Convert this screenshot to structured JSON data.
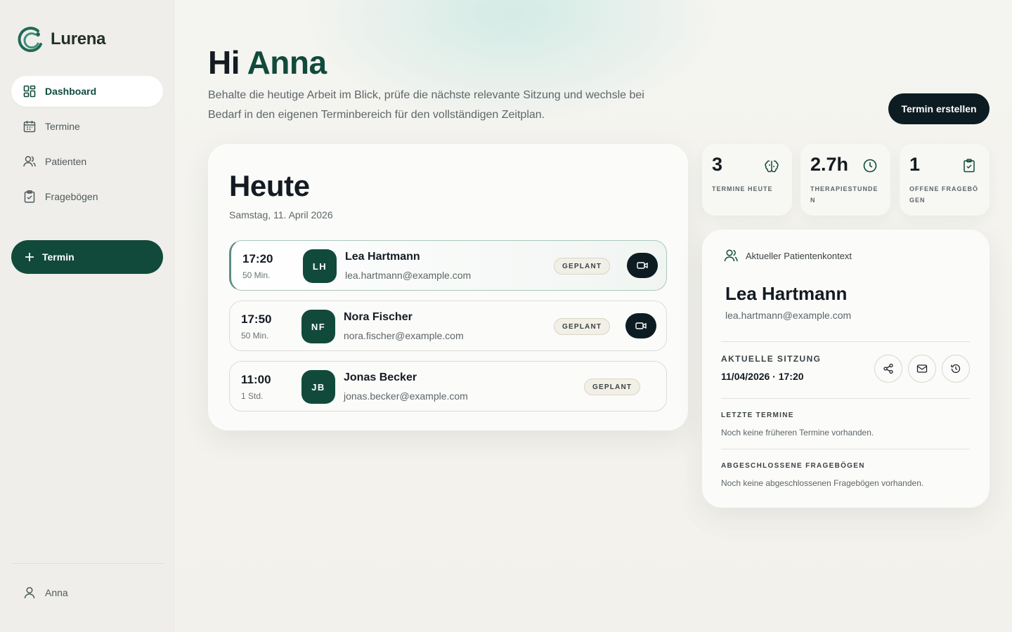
{
  "app": {
    "name": "Lurena"
  },
  "sidebar": {
    "items": [
      {
        "label": "Dashboard",
        "icon": "dashboard-icon",
        "active": true
      },
      {
        "label": "Termine",
        "icon": "calendar-icon"
      },
      {
        "label": "Patienten",
        "icon": "users-icon"
      },
      {
        "label": "Fragebögen",
        "icon": "clipboard-icon"
      }
    ],
    "new_button": "Termin",
    "user": "Anna"
  },
  "header": {
    "greeting": "Hi",
    "name": "Anna",
    "subtitle": "Behalte die heutige Arbeit im Blick, prüfe die nächste relevante Sitzung und wechsle bei Bedarf in den eigenen Terminbereich für den vollständigen Zeitplan.",
    "create_button": "Termin erstellen"
  },
  "today": {
    "title": "Heute",
    "date": "Samstag, 11. April 2026",
    "appointments": [
      {
        "time": "17:20",
        "duration": "50 Min.",
        "initials": "LH",
        "name": "Lea Hartmann",
        "email": "lea.hartmann@example.com",
        "status": "GEPLANT",
        "video": true
      },
      {
        "time": "17:50",
        "duration": "50 Min.",
        "initials": "NF",
        "name": "Nora Fischer",
        "email": "nora.fischer@example.com",
        "status": "GEPLANT",
        "video": true
      },
      {
        "time": "11:00",
        "duration": "1 Std.",
        "initials": "JB",
        "name": "Jonas Becker",
        "email": "jonas.becker@example.com",
        "status": "GEPLANT",
        "video": false
      }
    ]
  },
  "stats": [
    {
      "value": "3",
      "label": "TERMINE HEUTE",
      "icon": "brain-icon"
    },
    {
      "value": "2.7h",
      "label": "THERAPIESTUNDEN",
      "icon": "clock-icon"
    },
    {
      "value": "1",
      "label": "OFFENE FRAGEBÖGEN",
      "icon": "clipboard-check-icon"
    }
  ],
  "context": {
    "header": "Aktueller Patientenkontext",
    "name": "Lea Hartmann",
    "email": "lea.hartmann@example.com",
    "session_label": "AKTUELLE SITZUNG",
    "session_value": "11/04/2026 · 17:20",
    "recent_label": "LETZTE TERMINE",
    "recent_text": "Noch keine früheren Termine vorhanden.",
    "forms_label": "ABGESCHLOSSENE FRAGEBÖGEN",
    "forms_text": "Noch keine abgeschlossenen Fragebögen vorhanden."
  },
  "colors": {
    "brand": "#114a3b",
    "dark": "#0c1c22",
    "background": "#f3f1ec"
  }
}
